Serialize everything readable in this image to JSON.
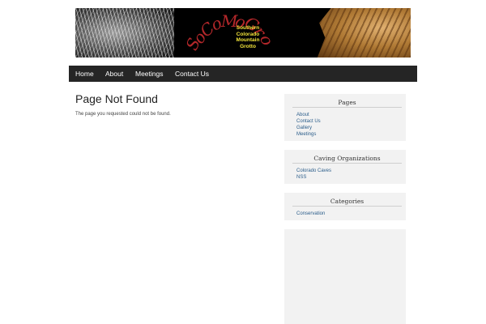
{
  "header": {
    "logo_script": [
      "S",
      "o",
      "C",
      "o",
      "M",
      "o",
      "G",
      "r",
      "o"
    ],
    "logo_lines": [
      "Southern",
      "Colorado",
      "Mountain",
      "Grotto"
    ],
    "colors": {
      "script": "#b3272a",
      "text": "#f2e43a"
    }
  },
  "nav": {
    "items": [
      {
        "label": "Home"
      },
      {
        "label": "About"
      },
      {
        "label": "Meetings"
      },
      {
        "label": "Contact Us"
      }
    ]
  },
  "main": {
    "title": "Page Not Found",
    "message": "The page you requested could not be found."
  },
  "sidebar": {
    "pages": {
      "title": "Pages",
      "links": [
        "About",
        "Contact Us",
        "Gallery",
        "Meetings"
      ]
    },
    "orgs": {
      "title": "Caving Organizations",
      "links": [
        "Colorado Caves",
        "NSS"
      ]
    },
    "categories": {
      "title": "Categories",
      "links": [
        "Conservation"
      ]
    }
  }
}
